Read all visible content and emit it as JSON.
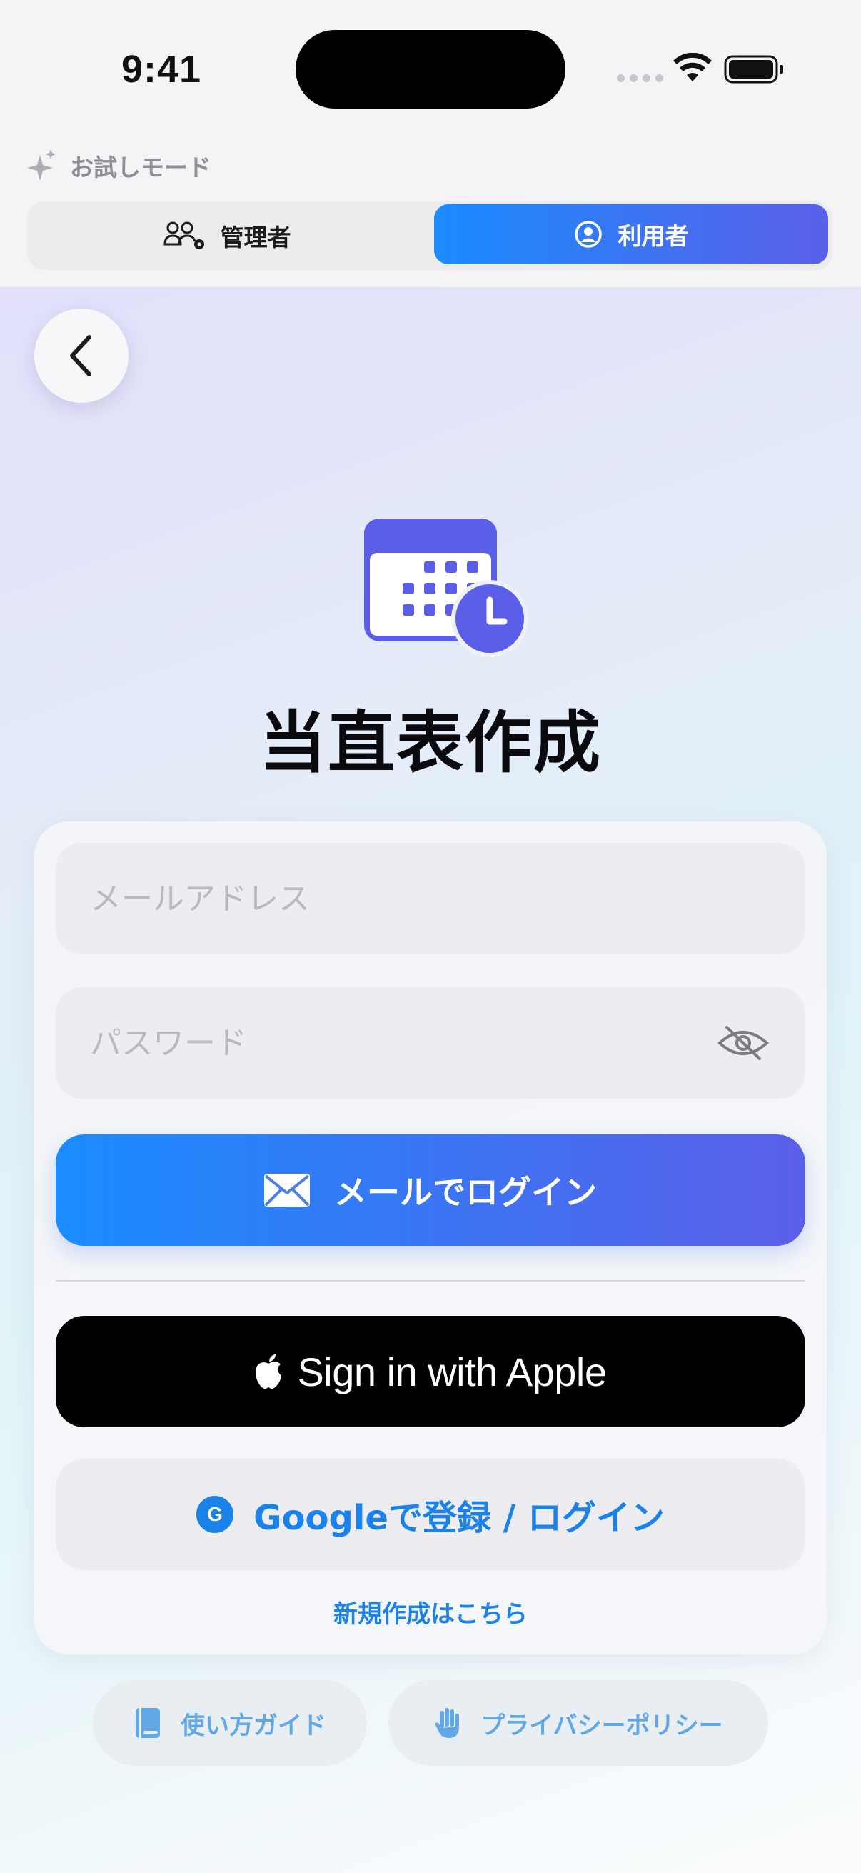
{
  "status_bar": {
    "time": "9:41"
  },
  "trial": {
    "label": "お試しモード"
  },
  "role_selector": {
    "admin_label": "管理者",
    "user_label": "利用者",
    "selected": "利用者"
  },
  "app": {
    "title": "当直表作成"
  },
  "login_form": {
    "email_placeholder": "メールアドレス",
    "email_value": "",
    "password_placeholder": "パスワード",
    "password_value": "",
    "mail_login_label": "メールでログイン",
    "apple_label": "Sign in with Apple",
    "google_icon_letter": "G",
    "google_label": "Googleで登録 / ログイン",
    "signup_label": "新規作成はこちら"
  },
  "footer": {
    "guide_label": "使い方ガイド",
    "privacy_label": "プライバシーポリシー"
  },
  "icons": {
    "back": "chevron-left-icon",
    "trial": "sparkle-icon",
    "admin": "users-gear-icon",
    "user": "user-circle-icon",
    "app": "calendar-clock-icon",
    "password_toggle": "eye-slash-icon",
    "mail": "envelope-icon",
    "apple": "apple-logo-icon",
    "google": "google-icon",
    "guide": "book-icon",
    "privacy": "hand-raised-icon"
  },
  "colors": {
    "accent_start": "#1a8cff",
    "accent_end": "#5b5fe8",
    "app_icon": "#5b5fe8",
    "link": "#1a82e8",
    "footer_text": "#62a8e6"
  }
}
